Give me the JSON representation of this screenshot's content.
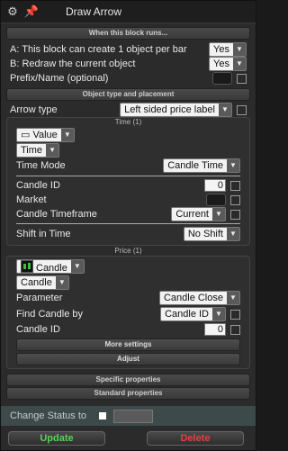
{
  "window": {
    "title": "Draw Arrow"
  },
  "block_runs": {
    "header": "When this block runs...",
    "row_a": {
      "label": "A: This block can create 1 object per bar",
      "value": "Yes"
    },
    "row_b": {
      "label": "B: Redraw the current object",
      "value": "Yes"
    },
    "prefix": {
      "label": "Prefix/Name (optional)"
    }
  },
  "placement": {
    "header": "Object type and placement",
    "arrow_type": {
      "label": "Arrow type",
      "value": "Left sided price label"
    },
    "time_caption": "Time (1)",
    "value_select": "Value",
    "time_select": "Time",
    "time_mode": {
      "label": "Time Mode",
      "value": "Candle Time"
    },
    "candle_id": {
      "label": "Candle ID",
      "value": "0"
    },
    "market": {
      "label": "Market"
    },
    "candle_timeframe": {
      "label": "Candle Timeframe",
      "value": "Current"
    },
    "shift_in_time": {
      "label": "Shift in Time",
      "value": "No Shift"
    },
    "price_caption": "Price (1)",
    "candle_select_1": "Candle",
    "candle_select_2": "Candle",
    "parameter": {
      "label": "Parameter",
      "value": "Candle Close"
    },
    "find_candle_by": {
      "label": "Find Candle by",
      "value": "Candle ID"
    },
    "price_candle_id": {
      "label": "Candle ID",
      "value": "0"
    },
    "more_settings": "More settings",
    "adjust": "Adjust"
  },
  "specific_properties": "Specific properties",
  "standard_properties": "Standard properties",
  "change_status": {
    "label": "Change Status to"
  },
  "buttons": {
    "update": "Update",
    "delete": "Delete"
  }
}
